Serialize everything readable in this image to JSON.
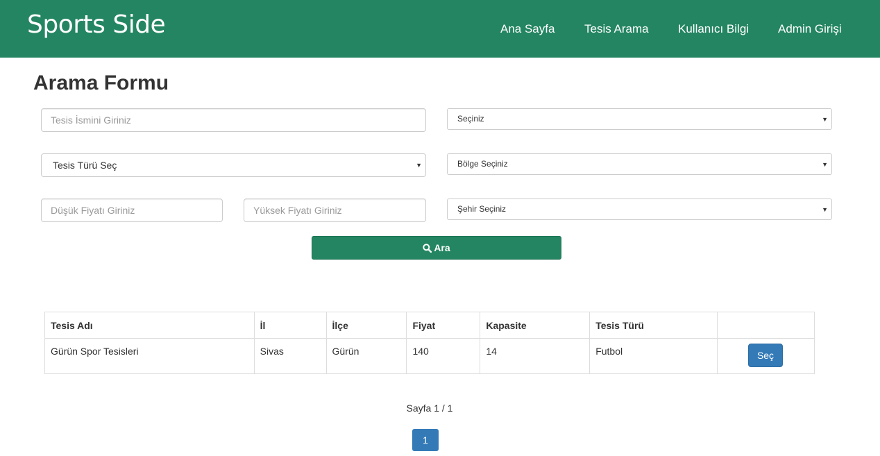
{
  "navbar": {
    "brand": "Sports Side",
    "items": [
      {
        "label": "Ana Sayfa"
      },
      {
        "label": "Tesis Arama"
      },
      {
        "label": "Kullanıcı Bilgi"
      },
      {
        "label": "Admin Girişi"
      }
    ]
  },
  "form": {
    "title": "Arama Formu",
    "facility_name_placeholder": "Tesis İsmini Giriniz",
    "select_default": "Seçiniz",
    "facility_type_select": "Tesis Türü Seç",
    "region_select": "Bölge Seçiniz",
    "min_price_placeholder": "Düşük Fiyatı Giriniz",
    "max_price_placeholder": "Yüksek Fiyatı Giriniz",
    "city_select": "Şehir Seçiniz",
    "search_button": "Ara"
  },
  "results": {
    "columns": [
      "Tesis Adı",
      "İl",
      "İlçe",
      "Fiyat",
      "Kapasite",
      "Tesis Türü",
      ""
    ],
    "rows": [
      {
        "name": "Gürün Spor Tesisleri",
        "city": "Sivas",
        "district": "Gürün",
        "price": "140",
        "capacity": "14",
        "type": "Futbol",
        "action": "Seç"
      }
    ]
  },
  "pagination": {
    "label": "Sayfa 1 / 1",
    "current": "1"
  },
  "colors": {
    "primary_green": "#238562",
    "button_blue": "#337ab7"
  },
  "icons": {
    "search": "search-icon"
  }
}
